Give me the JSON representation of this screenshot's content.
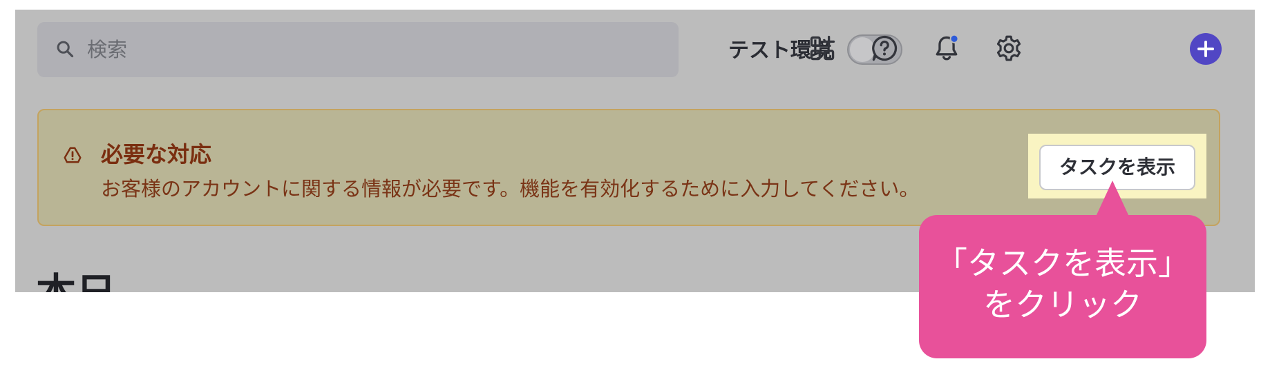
{
  "search": {
    "placeholder": "検索"
  },
  "header": {
    "test_env_label": "テスト環境",
    "test_env_enabled": false,
    "icons": [
      "apps-icon",
      "help-icon",
      "bell-icon",
      "gear-icon",
      "plus-icon"
    ],
    "accent_color": "#5146c4",
    "notification_dot_color": "#2e5bd9"
  },
  "alert": {
    "title": "必要な対応",
    "message": "お客様のアカウントに関する情報が必要です。機能を有効化するために入力してください。",
    "button_label": "タスクを表示",
    "icon": "warning-icon"
  },
  "main": {
    "heading": "本日"
  },
  "callout": {
    "line1": "「タスクを表示」",
    "line2": "をクリック",
    "color": "#e8519a"
  }
}
